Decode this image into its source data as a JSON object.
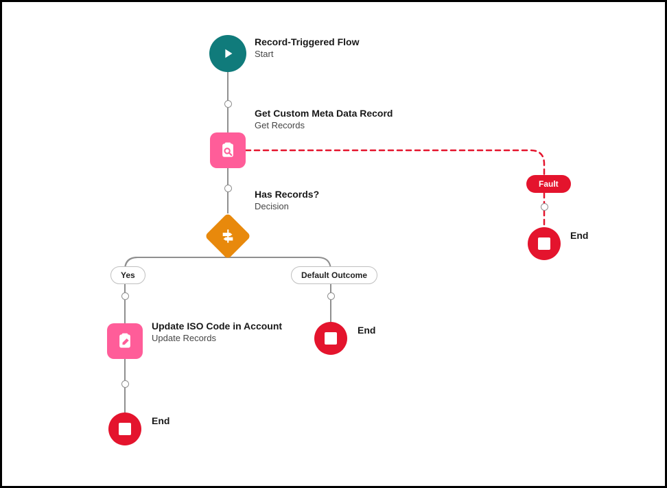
{
  "start": {
    "title": "Record-Triggered Flow",
    "subtitle": "Start"
  },
  "getRecords": {
    "title": "Get Custom Meta Data Record",
    "subtitle": "Get Records"
  },
  "decision": {
    "title": "Has Records?",
    "subtitle": "Decision"
  },
  "updateRecords": {
    "title": "Update ISO Code in Account",
    "subtitle": "Update Records"
  },
  "outcomes": {
    "yes": "Yes",
    "default": "Default Outcome"
  },
  "fault": {
    "label": "Fault"
  },
  "end": {
    "label": "End"
  },
  "colors": {
    "teal": "#107b7b",
    "pink": "#ff5d99",
    "orange": "#e8890c",
    "red": "#e4142d",
    "gray": "#8f8f8f"
  }
}
